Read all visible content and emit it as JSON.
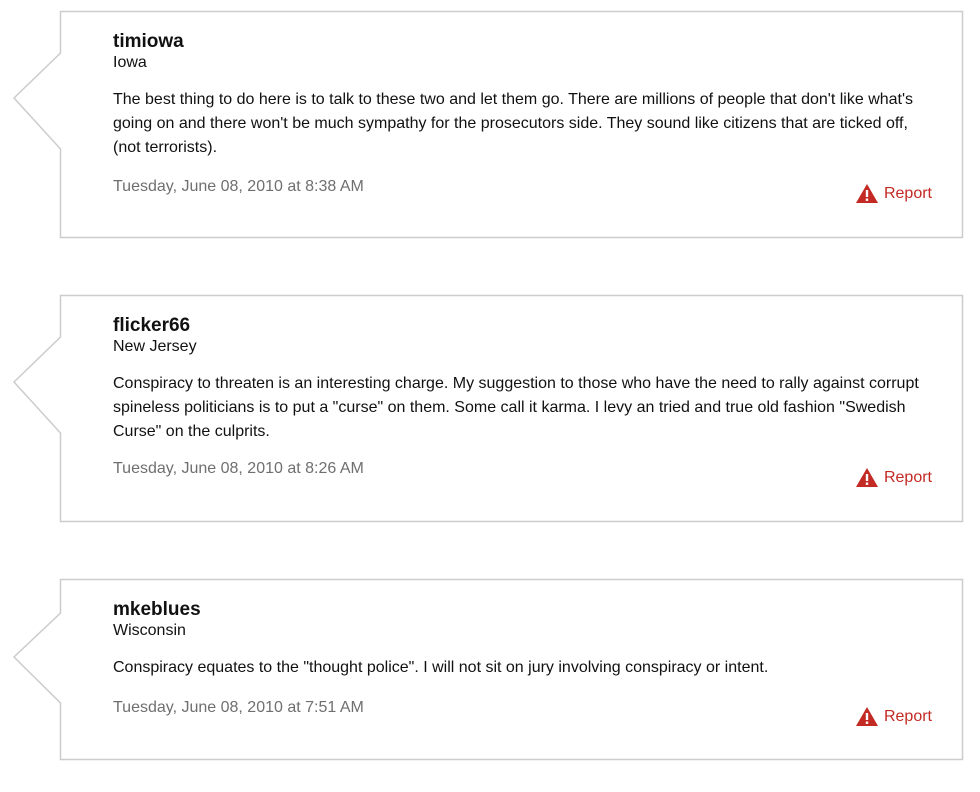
{
  "comments": [
    {
      "username": "timiowa",
      "location": "Iowa",
      "body": "The best thing to do here is to talk to these two and let them go. There are millions of people that don't like what's going on and there won't be much sympathy for the prosecutors side. They sound like citizens that are ticked off, (not terrorists).",
      "timestamp": "Tuesday, June 08, 2010 at 8:38 AM",
      "report_label": "Report"
    },
    {
      "username": "flicker66",
      "location": "New Jersey",
      "body": "Conspiracy to threaten is an interesting charge. My suggestion to those who have the need to rally against corrupt spineless politicians is to put a \"curse\" on them. Some call it karma. I levy an tried and true old fashion \"Swedish Curse\" on the culprits.",
      "timestamp": "Tuesday, June 08, 2010 at 8:26 AM",
      "report_label": "Report"
    },
    {
      "username": "mkeblues",
      "location": "Wisconsin",
      "body": "Conspiracy equates to the \"thought police\". I will not sit on jury involving conspiracy or intent.",
      "timestamp": "Tuesday, June 08, 2010 at 7:51 AM",
      "report_label": "Report"
    }
  ],
  "colors": {
    "border": "#cccccc",
    "text": "#111111",
    "timestamp": "#6f6f6f",
    "report": "#c32a23"
  },
  "icons": {
    "report": "warning-triangle-icon"
  }
}
